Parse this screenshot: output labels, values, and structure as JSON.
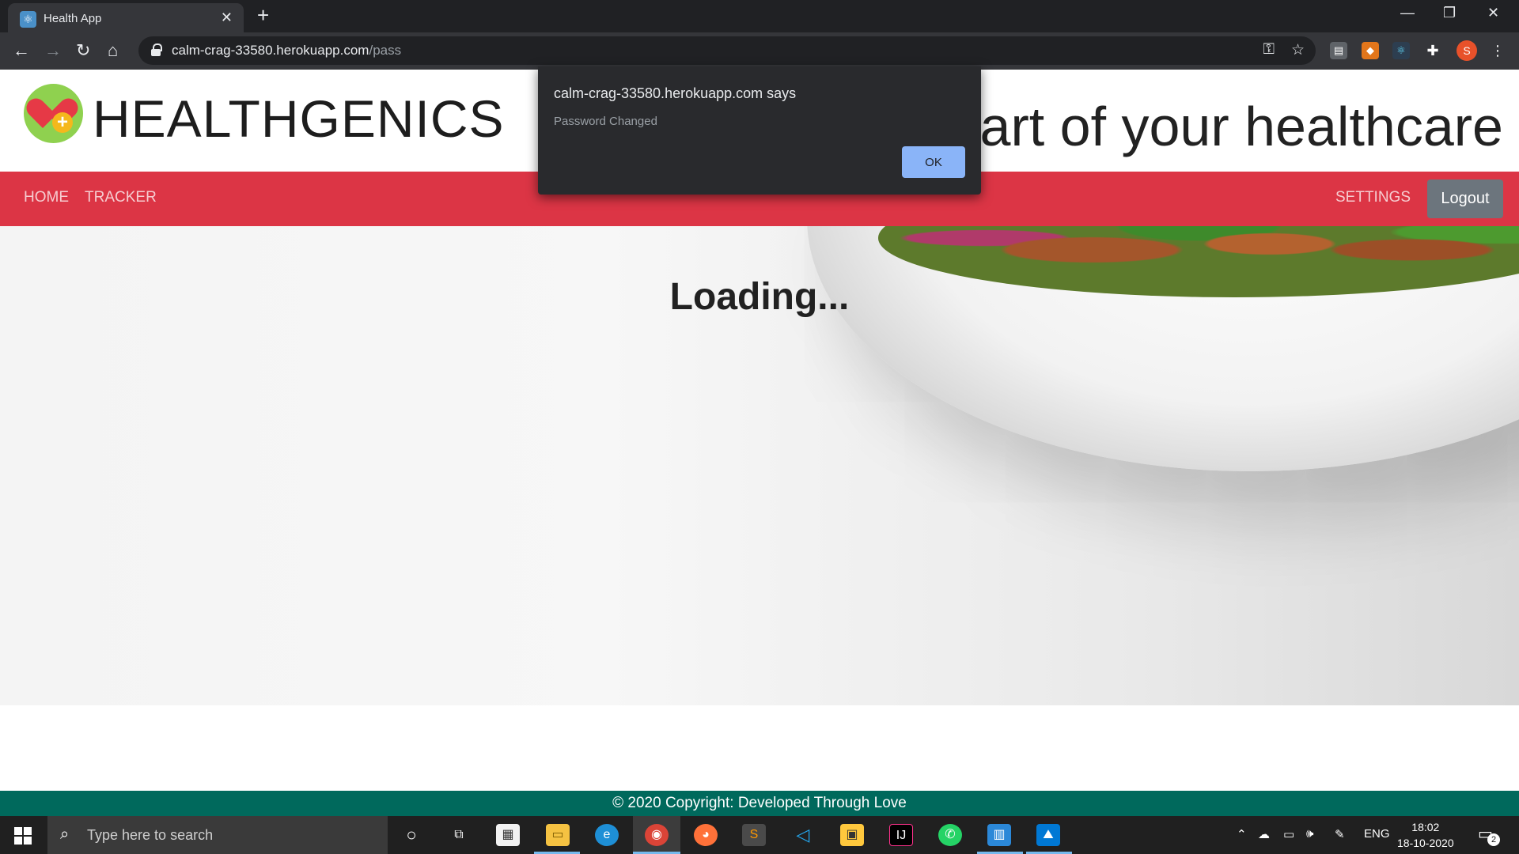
{
  "browser": {
    "tab_title": "Health App",
    "tab_close": "✕",
    "new_tab": "+",
    "url_host": "calm-crag-33580.herokuapp.com",
    "url_path": "/pass",
    "profile_initial": "S"
  },
  "page": {
    "brand": "HEALTHGENICS",
    "tagline": "eart of your healthcare",
    "nav_left": [
      "HOME",
      "TRACKER"
    ],
    "nav_settings": "SETTINGS",
    "logout": "Logout",
    "loading": "Loading...",
    "footer": "© 2020 Copyright: Developed Through Love"
  },
  "dialog": {
    "title": "calm-crag-33580.herokuapp.com says",
    "message": "Password Changed",
    "ok": "OK"
  },
  "taskbar": {
    "search_placeholder": "Type here to search",
    "lang": "ENG",
    "time": "18:02",
    "date": "18-10-2020",
    "notifications": "2"
  },
  "colors": {
    "navbar": "#dc3545",
    "footer": "#00695c",
    "dialog_button": "#8ab4f8"
  }
}
